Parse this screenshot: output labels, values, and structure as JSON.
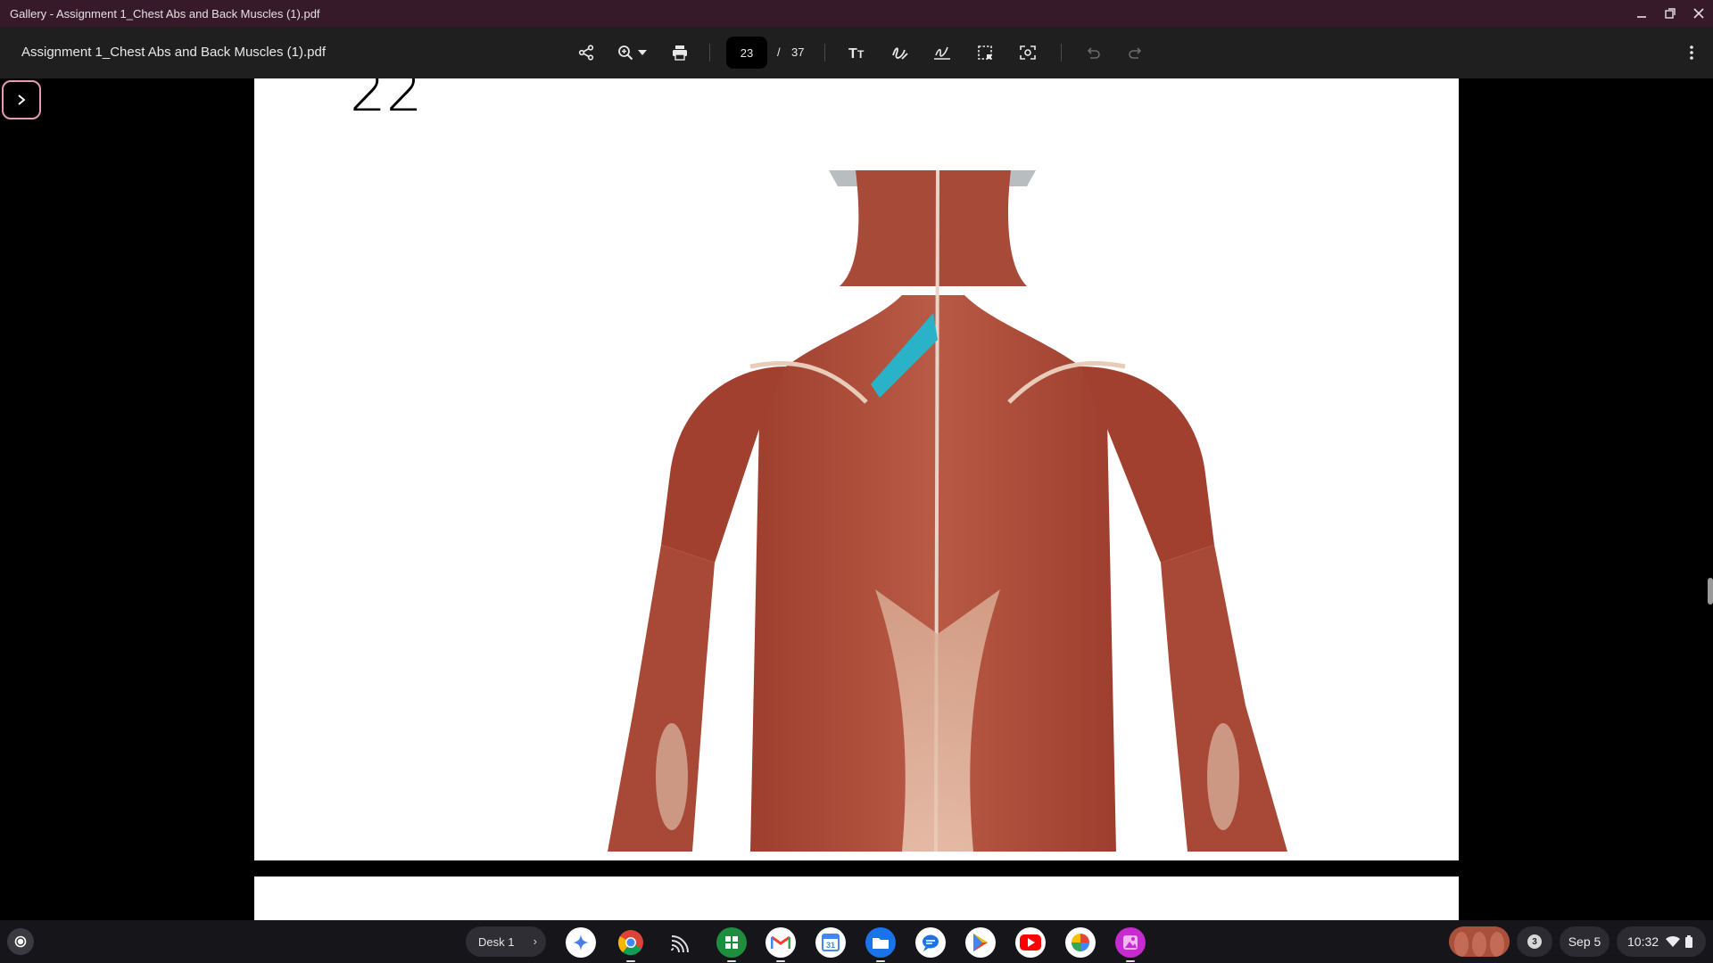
{
  "window": {
    "title": "Gallery - Assignment 1_Chest Abs and Back Muscles (1).pdf"
  },
  "toolbar": {
    "document_name": "Assignment 1_Chest Abs and Back Muscles (1).pdf",
    "current_page": "23",
    "page_separator": "/",
    "total_pages": "37"
  },
  "document": {
    "page_number_label": "22",
    "figure_icon": "posterior-back-muscles-anatomy-illustration",
    "highlight_color": "#2ab3c8"
  },
  "shelf": {
    "desk_label": "Desk 1",
    "notification_count": "3",
    "date": "Sep 5",
    "time": "10:32",
    "apps": [
      "gemini",
      "chrome",
      "cast",
      "sheets",
      "gmail",
      "calendar",
      "files",
      "messages",
      "play-store",
      "youtube",
      "photos",
      "gallery"
    ]
  },
  "colors": {
    "titlebar": "#361a29",
    "toolbar": "#1f1f1f",
    "accent": "#e59ab8"
  }
}
